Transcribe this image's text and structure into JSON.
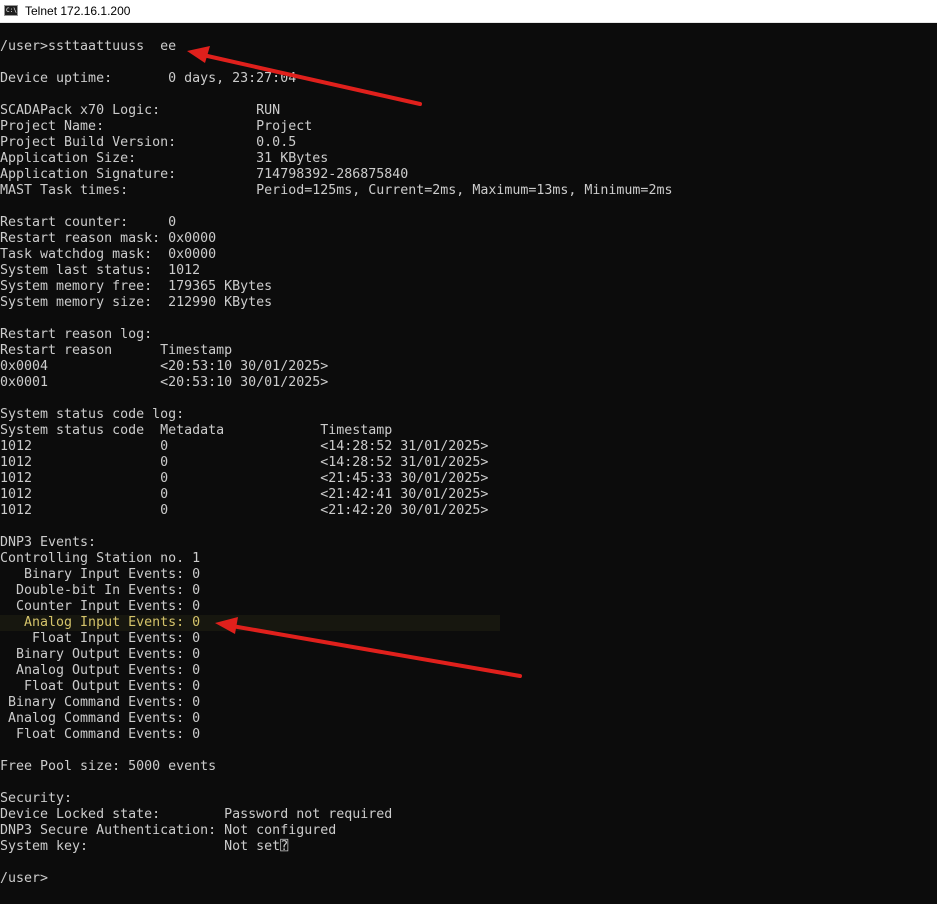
{
  "window": {
    "title": "Telnet 172.16.1.200",
    "icon": "console-icon",
    "icon_text": "C:\\"
  },
  "colors": {
    "console_bg": "#0c0c0c",
    "console_text": "#cccccc",
    "highlight_text": "#d4c36a",
    "arrow": "#e0201c"
  },
  "console": {
    "lines": [
      "/user>ssttaattuuss  ee",
      "Device uptime:       0 days, 23:27:04",
      "SCADAPack x70 Logic:            RUN",
      "Project Name:                   Project",
      "Project Build Version:          0.0.5",
      "Application Size:               31 KBytes",
      "Application Signature:          714798392-286875840",
      "MAST Task times:                Period=125ms, Current=2ms, Maximum=13ms, Minimum=2ms",
      "Restart counter:     0",
      "Restart reason mask: 0x0000",
      "Task watchdog mask:  0x0000",
      "System last status:  1012",
      "System memory free:  179365 KBytes",
      "System memory size:  212990 KBytes",
      "Restart reason log:",
      "Restart reason      Timestamp",
      "0x0004              <20:53:10 30/01/2025>",
      "0x0001              <20:53:10 30/01/2025>",
      "System status code log:",
      "System status code  Metadata            Timestamp",
      "1012                0                   <14:28:52 31/01/2025>",
      "1012                0                   <14:28:52 31/01/2025>",
      "1012                0                   <21:45:33 30/01/2025>",
      "1012                0                   <21:42:41 30/01/2025>",
      "1012                0                   <21:42:20 30/01/2025>",
      "DNP3 Events:",
      "Controlling Station no. 1",
      "   Binary Input Events: 0",
      "  Double-bit In Events: 0",
      "  Counter Input Events: 0",
      "   Analog Input Events: 0",
      "    Float Input Events: 0",
      "  Binary Output Events: 0",
      "  Analog Output Events: 0",
      "   Float Output Events: 0",
      " Binary Command Events: 0",
      " Analog Command Events: 0",
      "  Float Command Events: 0",
      "Free Pool size: 5000 events",
      "Security:",
      "Device Locked state:        Password not required",
      "DNP3 Secure Authentication: Not configured",
      "System key:                 Not set⍰",
      "/user>"
    ]
  }
}
